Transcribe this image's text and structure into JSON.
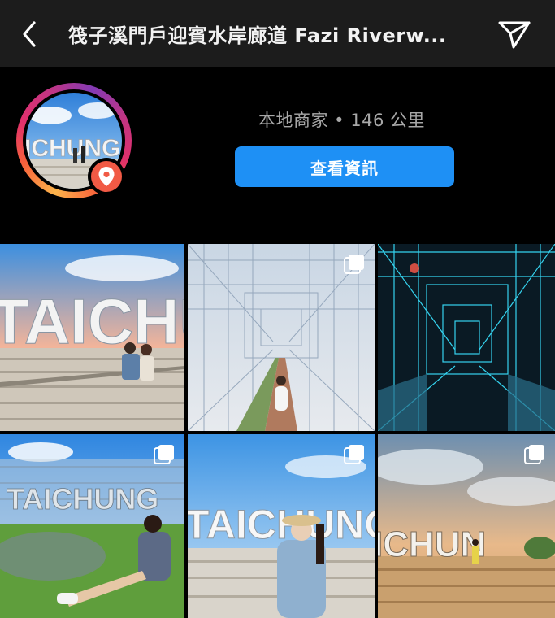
{
  "header": {
    "title": "筏子溪門戶迎賓水岸廊道 Fazi Riverw...",
    "back_icon": "chevron-left-icon",
    "share_icon": "paper-plane-icon"
  },
  "profile": {
    "avatar_text": "ICHUNG",
    "meta_text": "本地商家 • 146 公里",
    "info_button_label": "查看資訊",
    "badge_icon": "location-pin-icon"
  },
  "grid": {
    "tiles": [
      {
        "name": "taichung-steps-couple",
        "photo_text": "TAICHUN",
        "multi": false
      },
      {
        "name": "wire-corridor-girl",
        "photo_text": "",
        "multi": true
      },
      {
        "name": "neon-wire-tunnel",
        "photo_text": "",
        "multi": false
      },
      {
        "name": "taichung-lawn-woman",
        "photo_text": "TAICHUNG",
        "multi": true
      },
      {
        "name": "taichung-hat-woman",
        "photo_text": "TAICHUNG",
        "multi": true
      },
      {
        "name": "taichung-sunset-sign",
        "photo_text": "ICHUN",
        "multi": true
      }
    ]
  },
  "colors": {
    "button_blue": "#1e90f5",
    "badge_red": "#f15a45",
    "topbar": "#1c1c1c"
  }
}
